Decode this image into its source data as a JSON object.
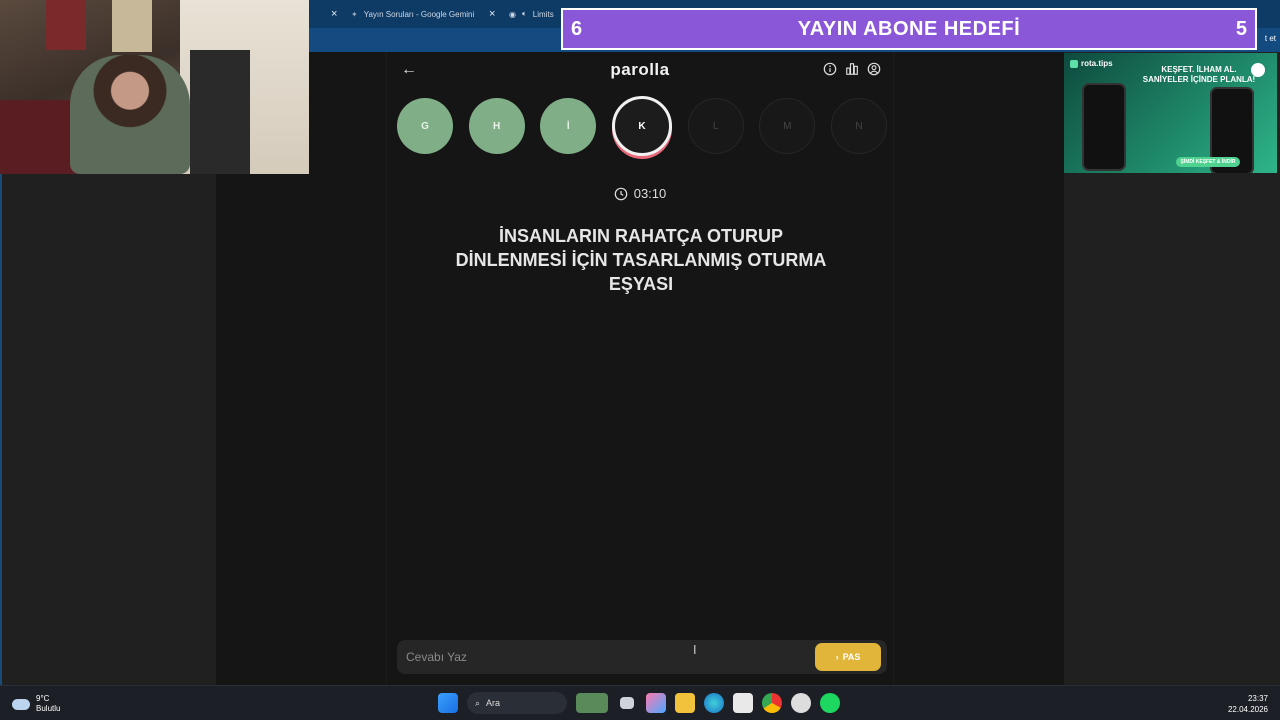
{
  "browser": {
    "tabs": [
      {
        "label": "Yayın Soruları - Google Gemini"
      },
      {
        "label": "Limits"
      }
    ],
    "right_text": "t et"
  },
  "goal": {
    "left_value": "6",
    "title": "YAYIN ABONE HEDEFİ",
    "right_value": "5"
  },
  "ad": {
    "brand": "rota.tips",
    "line1": "KEŞFET. İLHAM AL.",
    "line2": "SANİYELER İÇİNDE PLANLA!",
    "cta": "ŞİMDİ KEŞFET & İNDİR"
  },
  "game": {
    "brand": "parolla",
    "letters": [
      {
        "char": "G",
        "state": "done"
      },
      {
        "char": "H",
        "state": "done"
      },
      {
        "char": "İ",
        "state": "done"
      },
      {
        "char": "K",
        "state": "current"
      },
      {
        "char": "L",
        "state": "future"
      },
      {
        "char": "M",
        "state": "future"
      },
      {
        "char": "N",
        "state": "future"
      }
    ],
    "timer": "03:10",
    "question": "İNSANLARIN RAHATÇA OTURUP DİNLENMESİ İÇİN TASARLANMIŞ OTURMA EŞYASI",
    "answer_placeholder": "Cevabı Yaz",
    "pass_label": "PAS",
    "colors": {
      "done": "#7fae87",
      "pass": "#e0b53a",
      "current_ring": "#e86a7a"
    }
  },
  "taskbar": {
    "weather_temp": "9°C",
    "weather_desc": "Bulutlu",
    "search_label": "Ara",
    "time": "23:37",
    "date": "22.04.2026"
  }
}
